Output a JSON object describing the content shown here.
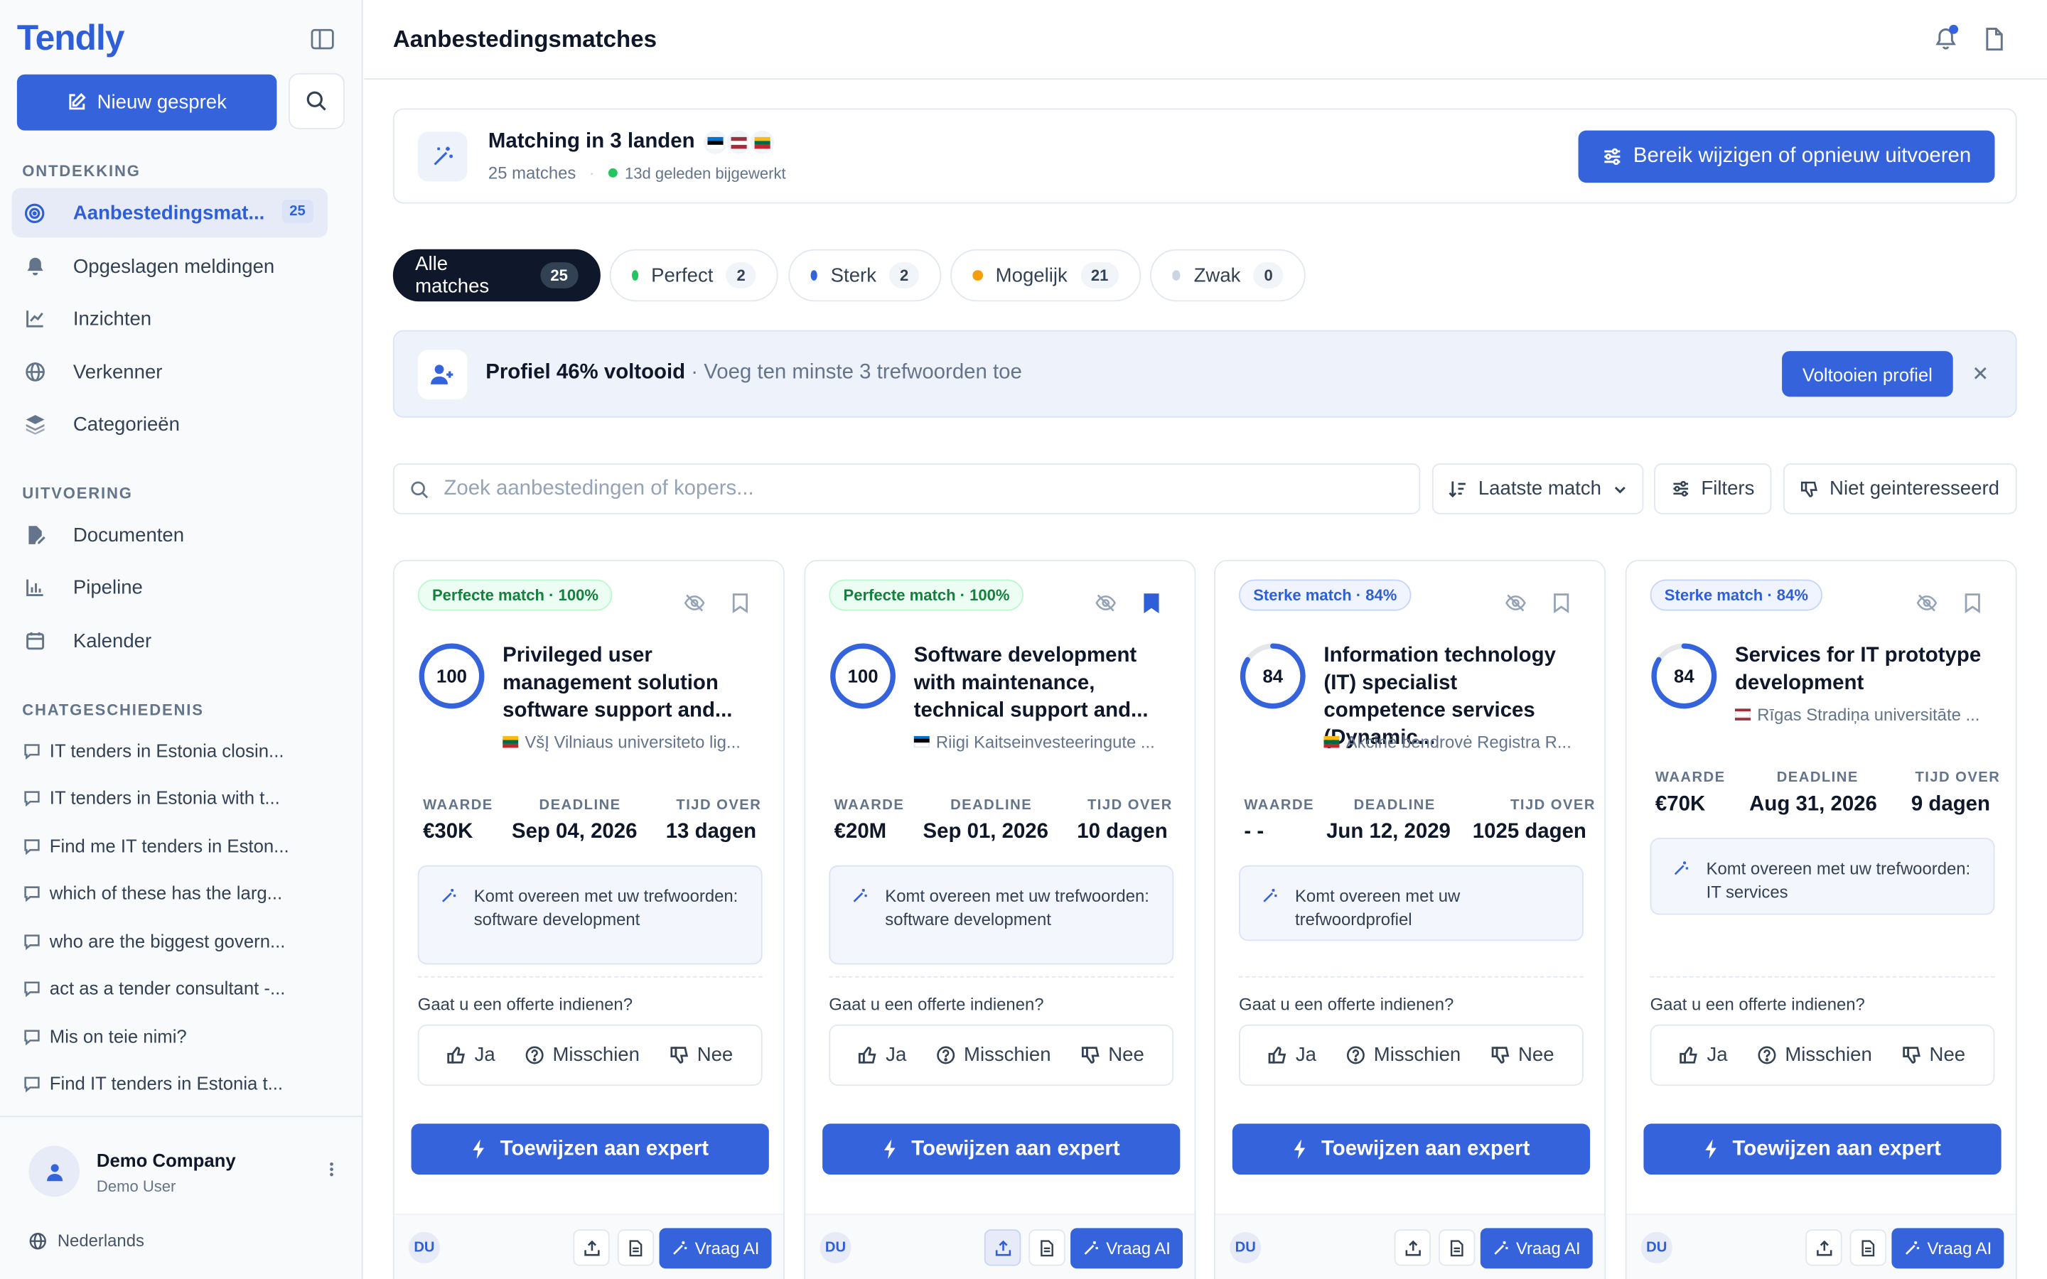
{
  "app": {
    "logo": "Tendly"
  },
  "sidebar": {
    "new_chat_label": "Nieuw gesprek",
    "sections": {
      "discovery": "ONTDEKKING",
      "execution": "UITVOERING",
      "history": "CHATGESCHIEDENIS"
    },
    "nav": [
      {
        "label": "Aanbestedingsmat...",
        "icon": "target-icon",
        "badge": "25",
        "active": true
      },
      {
        "label": "Opgeslagen meldingen",
        "icon": "bell-icon"
      },
      {
        "label": "Inzichten",
        "icon": "chart-line-icon"
      },
      {
        "label": "Verkenner",
        "icon": "globe-icon"
      },
      {
        "label": "Categorieën",
        "icon": "layers-icon"
      }
    ],
    "nav2": [
      {
        "label": "Documenten",
        "icon": "file-edit-icon"
      },
      {
        "label": "Pipeline",
        "icon": "bar-chart-icon"
      },
      {
        "label": "Kalender",
        "icon": "calendar-icon"
      }
    ],
    "chats": [
      "IT tenders in Estonia closin...",
      "IT tenders in Estonia with t...",
      "Find me IT tenders in Eston...",
      "which of these has the larg...",
      "who are the biggest govern...",
      "act as a tender consultant -...",
      "Mis on teie nimi?",
      "Find IT tenders in Estonia t..."
    ],
    "user": {
      "company": "Demo Company",
      "name": "Demo User"
    },
    "language": "Nederlands"
  },
  "header": {
    "title": "Aanbestedingsmatches"
  },
  "summary": {
    "title": "Matching in 3 landen",
    "count": "25 matches",
    "updated": "13d geleden bijgewerkt",
    "button": "Bereik wijzigen of opnieuw uitvoeren"
  },
  "filters": [
    {
      "label": "Alle matches",
      "count": "25",
      "active": true
    },
    {
      "label": "Perfect",
      "count": "2",
      "color": "#22c55e"
    },
    {
      "label": "Sterk",
      "count": "2",
      "color": "#3563dc"
    },
    {
      "label": "Mogelijk",
      "count": "21",
      "color": "#f59e0b"
    },
    {
      "label": "Zwak",
      "count": "0",
      "color": "#cbd5e1"
    }
  ],
  "banner": {
    "title": "Profiel 46% voltooid",
    "text": " · Voeg ten minste 3 trefwoorden toe",
    "button": "Voltooien  profiel"
  },
  "toolbar": {
    "search_placeholder": "Zoek aanbestedingen of kopers...",
    "sort": "Laatste match",
    "filters": "Filters",
    "not_interested": "Niet geinteresseerd"
  },
  "card_labels": {
    "value": "WAARDE",
    "deadline": "DEADLINE",
    "time_left": "TIJD OVER",
    "question": "Gaat u een offerte indienen?",
    "yes": "Ja",
    "maybe": "Misschien",
    "no": "Nee",
    "assign": "Toewijzen aan expert",
    "initials": "DU",
    "ask_ai": "Vraag AI"
  },
  "cards": [
    {
      "badge": "Perfecte match · 100%",
      "score": "100",
      "score_fraction": 1.0,
      "title": "Privileged user management solution software support and...",
      "buyer": "VšĮ Vilniaus universiteto lig...",
      "country": "LT",
      "value": "€30K",
      "deadline": "Sep 04, 2026",
      "time_left": "13 dagen",
      "reason": "Komt overeen met uw trefwoorden: software development",
      "bookmarked": false
    },
    {
      "badge": "Perfecte match · 100%",
      "score": "100",
      "score_fraction": 1.0,
      "title": "Software development with maintenance, technical support and...",
      "buyer": "Riigi Kaitseinvesteeringute ...",
      "country": "EE",
      "value": "€20M",
      "deadline": "Sep 01, 2026",
      "time_left": "10 dagen",
      "reason": "Komt overeen met uw trefwoorden: software development",
      "bookmarked": true
    },
    {
      "badge": "Sterke match · 84%",
      "score": "84",
      "score_fraction": 0.84,
      "title": "Information technology (IT) specialist competence services (Dynamic...",
      "buyer": "Akcinė bendrovė Registra  R...",
      "country": "LT",
      "value": "- -",
      "deadline": "Jun 12, 2029",
      "time_left": "1025 dagen",
      "reason": "Komt overeen met uw trefwoordprofiel",
      "bookmarked": false
    },
    {
      "badge": "Sterke match · 84%",
      "score": "84",
      "score_fraction": 0.84,
      "title": "Services for IT prototype development",
      "buyer": "Rīgas Stradiņa universitāte  ...",
      "country": "LV",
      "value": "€70K",
      "deadline": "Aug 31, 2026",
      "time_left": "9 dagen",
      "reason": "Komt overeen met uw trefwoorden: IT services",
      "bookmarked": false
    }
  ]
}
